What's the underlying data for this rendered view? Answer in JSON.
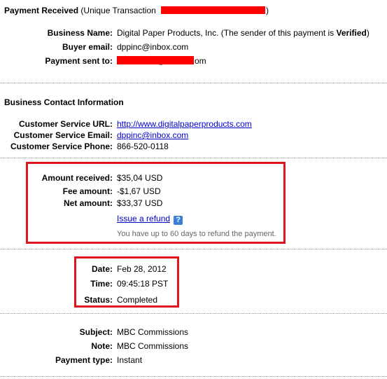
{
  "header": {
    "title": "Payment Received",
    "subtitle_start": "(Unique Transaction",
    "subtitle_end": ")"
  },
  "business": {
    "name_label": "Business Name:",
    "name_value": "Digital Paper Products, Inc.",
    "sender_note_start": "(The sender of this payment is ",
    "sender_status": "Verified",
    "sender_note_end": ")",
    "buyer_email_label": "Buyer email:",
    "buyer_email_value": "dppinc@inbox.com",
    "payment_sent_label": "Payment sent to:",
    "payment_sent_fragment_1": "@",
    "payment_sent_fragment_2": "om"
  },
  "contact": {
    "section_title": "Business Contact Information",
    "url_label": "Customer Service URL:",
    "url_value": "http://www.digitalpaperproducts.com",
    "email_label": "Customer Service Email:",
    "email_value": "dppinc@inbox.com",
    "phone_label": "Customer Service Phone:",
    "phone_value": "866-520-0118"
  },
  "amounts": {
    "received_label": "Amount received:",
    "received_value": "$35,04 USD",
    "fee_label": "Fee amount:",
    "fee_value": "-$1,67 USD",
    "net_label": "Net amount:",
    "net_value": "$33,37 USD",
    "refund_link": "Issue a refund",
    "help_icon": "?",
    "refund_note": "You have up to 60 days to refund the payment."
  },
  "timing": {
    "date_label": "Date:",
    "date_value": "Feb 28, 2012",
    "time_label": "Time:",
    "time_value": "09:45:18 PST",
    "status_label": "Status:",
    "status_value": "Completed"
  },
  "details": {
    "subject_label": "Subject:",
    "subject_value": "MBC Commissions",
    "note_label": "Note:",
    "note_value": "MBC Commissions",
    "type_label": "Payment type:",
    "type_value": "Instant"
  },
  "colors": {
    "link": "#0000cc",
    "highlight_box": "#e0141e",
    "redaction": "#ff0000",
    "help_icon_bg": "#3b7fd6"
  }
}
